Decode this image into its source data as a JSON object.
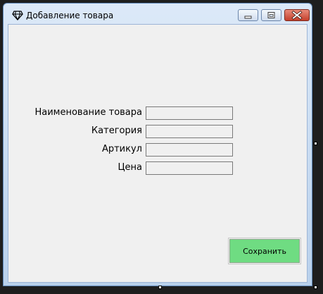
{
  "window": {
    "title": "Добавление товара",
    "icon": "diamond-icon",
    "minimize_icon": "minimize-icon",
    "maximize_icon": "maximize-icon",
    "close_icon": "close-icon"
  },
  "form": {
    "fields": [
      {
        "label": "Наименование товара",
        "value": ""
      },
      {
        "label": "Категория",
        "value": ""
      },
      {
        "label": "Артикул",
        "value": ""
      },
      {
        "label": "Цена",
        "value": ""
      }
    ],
    "save_label": "Сохранить"
  },
  "colors": {
    "client_background": "#f0f0f0",
    "save_button": "#6fdc82",
    "close_button": "#c4402c",
    "title_bar": "#b9d1ec",
    "designer_background": "#1e1e1e"
  }
}
